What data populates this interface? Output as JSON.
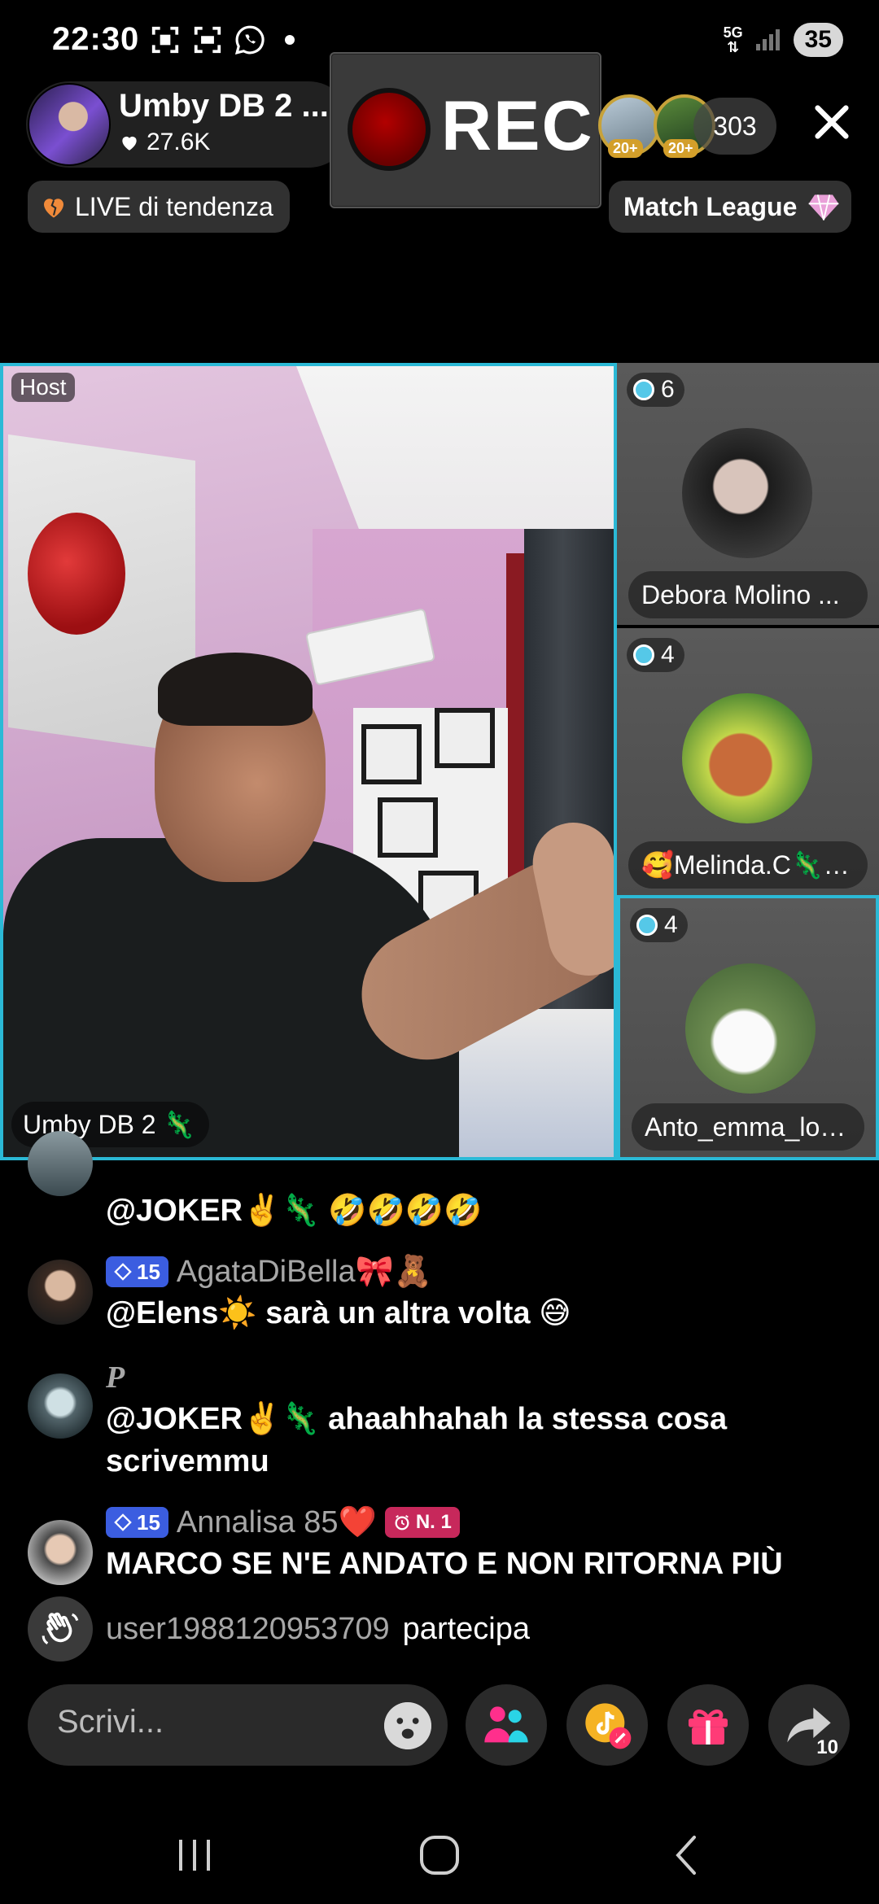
{
  "status_bar": {
    "time": "22:30",
    "network": "5G",
    "battery": "35",
    "icons_left": [
      "screenshot-icon",
      "screenshot-icon",
      "whatsapp-icon",
      "notification-dot-icon"
    ],
    "icons_right": [
      "network-5g-icon",
      "signal-icon",
      "battery-icon"
    ]
  },
  "host": {
    "name": "Umby DB 2 ...",
    "likes": "27.6K"
  },
  "recording": {
    "label": "REC"
  },
  "viewers": {
    "badge_1": "20+",
    "badge_2": "20+",
    "count": "303"
  },
  "pills": {
    "trending": "LIVE di tendenza",
    "match": "Match League"
  },
  "video": {
    "host_tag": "Host",
    "host_name_tag": "Umby DB 2",
    "host_name_emoji": "🦎"
  },
  "guests": [
    {
      "score": "6",
      "name": "Debora Molino ..."
    },
    {
      "score": "4",
      "name": "🥰Melinda.C🦎🦎"
    },
    {
      "score": "4",
      "name": "Anto_emma_lov..."
    }
  ],
  "chat": {
    "messages": [
      {
        "user": "",
        "level": "",
        "text": "@JOKER✌️🦎 🤣🤣🤣🤣"
      },
      {
        "user": "AgataDiBella🎀🧸",
        "level": "15",
        "text": "@Elens☀️ sarà un altra volta 😅"
      },
      {
        "user": "P",
        "level": "",
        "text": "@JOKER✌️🦎 ahaahhahah la stessa cosa scrivemmu"
      },
      {
        "user": "Annalisa 85❤️",
        "level": "15",
        "rank": "N. 1",
        "text": "MARCO SE N'E ANDATO E NON RITORNA PIÙ"
      }
    ],
    "join": {
      "user": "user1988120953709",
      "action": "partecipa"
    }
  },
  "toolbar": {
    "placeholder": "Scrivi...",
    "share_count": "10"
  },
  "colors": {
    "accent_border": "#2bb9d6",
    "level_badge": "#3b5de0",
    "rank_badge": "#c7285b",
    "rec_red": "#9a0000"
  }
}
